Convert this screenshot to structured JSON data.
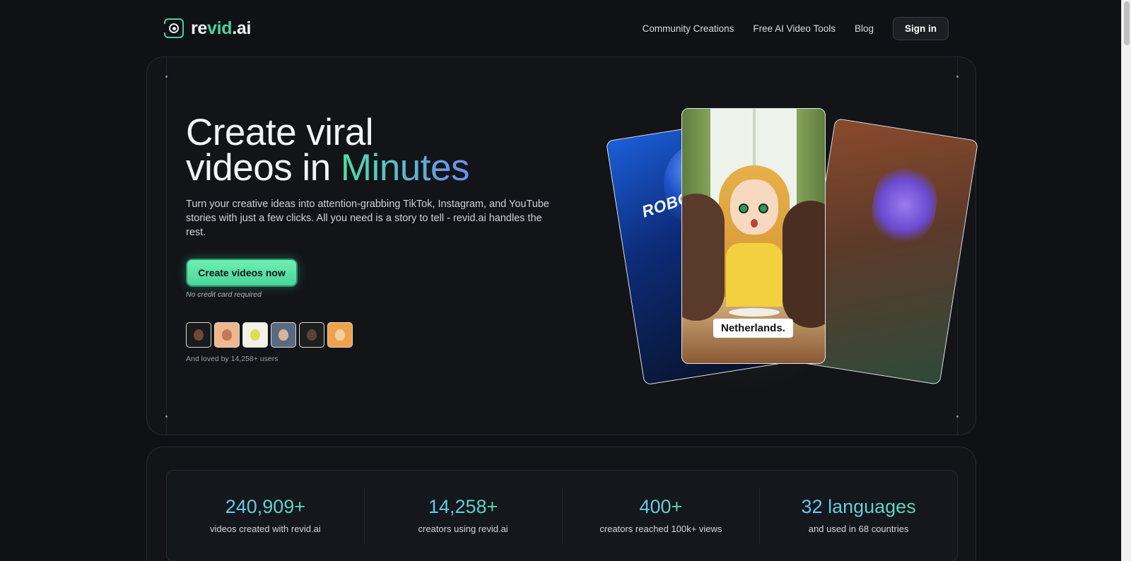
{
  "nav": {
    "logo_prefix": "re",
    "logo_accent": "vid",
    "logo_suffix": ".ai",
    "links": [
      "Community Creations",
      "Free AI Video Tools",
      "Blog"
    ],
    "signin_label": "Sign in"
  },
  "hero": {
    "title_line1": "Create viral",
    "title_line2_prefix": "videos in ",
    "title_line2_accent": "Minutes",
    "description": "Turn your creative ideas into attention-grabbing TikTok, Instagram, and YouTube stories with just a few clicks. All you need is a story to tell - revid.ai handles the rest.",
    "cta_label": "Create videos now",
    "cta_note": "No credit card required",
    "loved_text": "And loved by 14,258+ users",
    "card_left_text": "ROBO",
    "card_center_caption": "Netherlands."
  },
  "stats": [
    {
      "value": "240,909+",
      "label": "videos created with revid.ai"
    },
    {
      "value": "14,258+",
      "label": "creators using revid.ai"
    },
    {
      "value": "400+",
      "label": "creators reached 100k+ views"
    },
    {
      "value": "32 languages",
      "label": "and used in 68 countries"
    }
  ],
  "colors": {
    "accent_green": "#49d49a",
    "accent_blue": "#6d8df5",
    "background": "#0f1114"
  },
  "icons": {
    "logo": "camera-lens-icon"
  }
}
